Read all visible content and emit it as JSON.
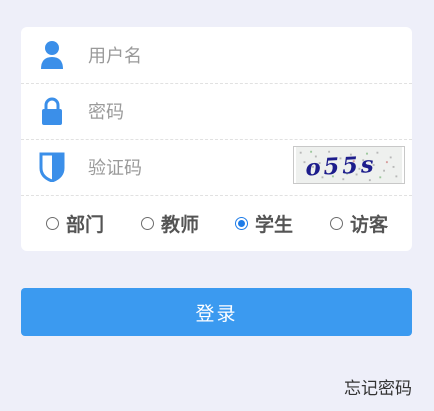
{
  "form": {
    "username_placeholder": "用户名",
    "password_placeholder": "密码",
    "captcha_placeholder": "验证码",
    "captcha_text": "o55s"
  },
  "roles": [
    {
      "label": "部门",
      "checked": false
    },
    {
      "label": "教师",
      "checked": false
    },
    {
      "label": "学生",
      "checked": true
    },
    {
      "label": "访客",
      "checked": false
    }
  ],
  "buttons": {
    "login_label": "登录",
    "forgot_label": "忘记密码"
  },
  "colors": {
    "accent": "#3b9af0",
    "icon": "#3b8fe9",
    "background": "#eeeff9"
  },
  "icons": {
    "username": "user-icon",
    "password": "lock-icon",
    "captcha": "shield-icon"
  }
}
